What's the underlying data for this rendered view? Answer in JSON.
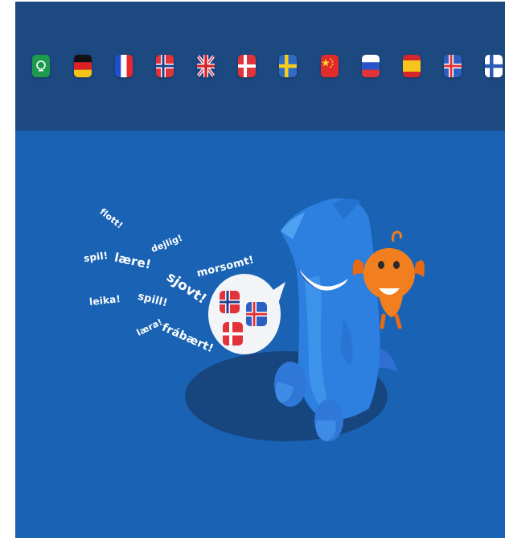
{
  "flags_bar": {
    "background": "#1c4980",
    "items": [
      {
        "name": "arabic",
        "icon": "arabic-flag-icon"
      },
      {
        "name": "german",
        "icon": "germany-flag-icon"
      },
      {
        "name": "french",
        "icon": "france-flag-icon"
      },
      {
        "name": "norwegian",
        "icon": "norway-flag-icon"
      },
      {
        "name": "english",
        "icon": "uk-flag-icon"
      },
      {
        "name": "danish",
        "icon": "denmark-flag-icon"
      },
      {
        "name": "swedish",
        "icon": "sweden-flag-icon"
      },
      {
        "name": "chinese",
        "icon": "china-flag-icon"
      },
      {
        "name": "russian",
        "icon": "russia-flag-icon"
      },
      {
        "name": "spanish",
        "icon": "spain-flag-icon"
      },
      {
        "name": "icelandic",
        "icon": "iceland-flag-icon"
      },
      {
        "name": "finnish",
        "icon": "finland-flag-icon"
      }
    ]
  },
  "hero": {
    "background": "#1a63b4",
    "words": {
      "flott": "flott!",
      "spil": "spil!",
      "laere": "lære!",
      "dejlig": "dejlig!",
      "morsomt": "morsomt!",
      "sjovt": "sjovt!",
      "leika": "leika!",
      "spill": "spill!",
      "laera": "læra!",
      "fraebaert": "frábært!"
    },
    "bubble_flags": [
      "norway-flag-icon",
      "iceland-flag-icon",
      "denmark-flag-icon"
    ]
  }
}
